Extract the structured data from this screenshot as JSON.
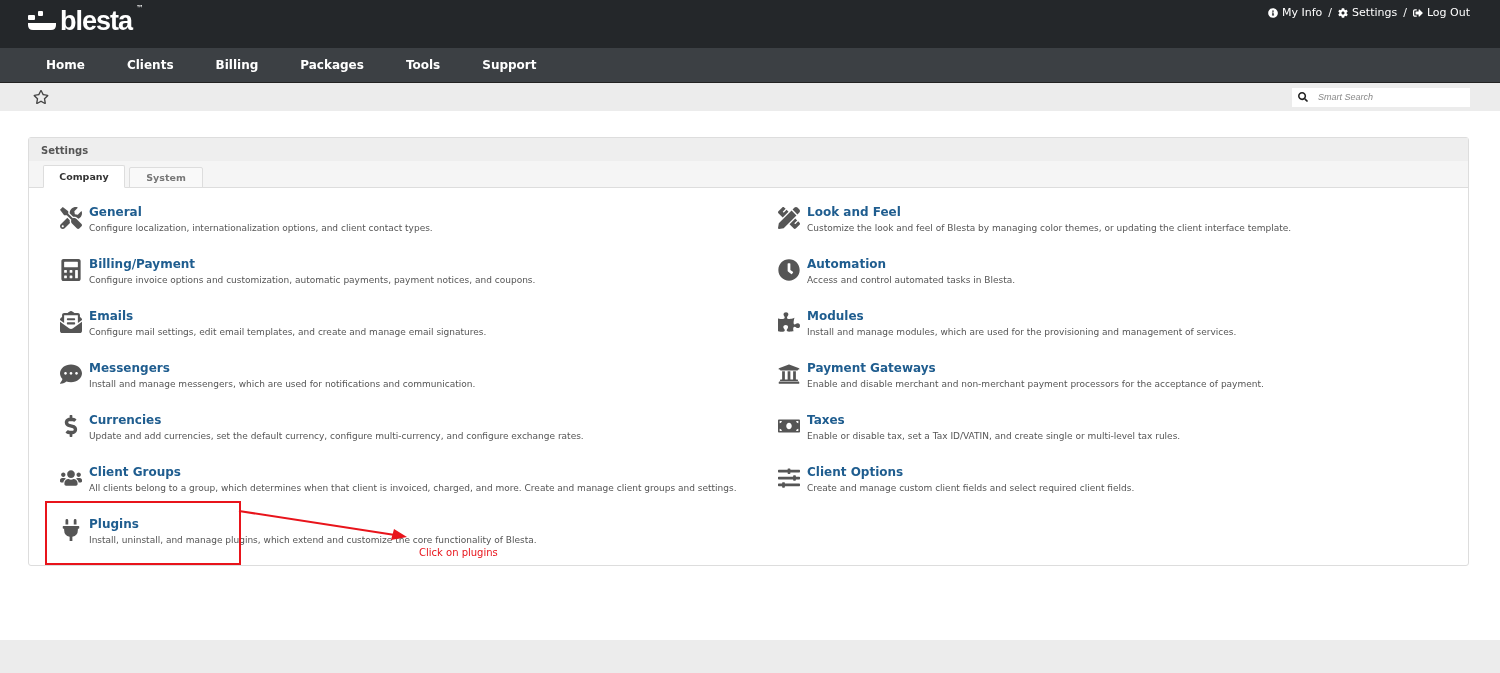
{
  "logo": {
    "text": "blesta",
    "trademark": "™"
  },
  "user_links": [
    {
      "label": "My Info",
      "kind": "info"
    },
    {
      "label": "Settings",
      "kind": "gear"
    },
    {
      "label": "Log Out",
      "kind": "logout"
    }
  ],
  "separator": "/",
  "nav": [
    "Home",
    "Clients",
    "Billing",
    "Packages",
    "Tools",
    "Support"
  ],
  "search": {
    "placeholder": "Smart Search"
  },
  "panel": {
    "title": "Settings",
    "tabs": [
      {
        "label": "Company",
        "selected": true
      },
      {
        "label": "System",
        "selected": false
      }
    ],
    "left_items": [
      {
        "title": "General",
        "description": "Configure localization, internationalization options, and client contact types."
      },
      {
        "title": "Billing/Payment",
        "description": "Configure invoice options and customization, automatic payments, payment notices, and coupons."
      },
      {
        "title": "Emails",
        "description": "Configure mail settings, edit email templates, and create and manage email signatures."
      },
      {
        "title": "Messengers",
        "description": "Install and manage messengers, which are used for notifications and communication."
      },
      {
        "title": "Currencies",
        "description": "Update and add currencies, set the default currency, configure multi-currency, and configure exchange rates."
      },
      {
        "title": "Client Groups",
        "description": "All clients belong to a group, which determines when that client is invoiced, charged, and more. Create and manage client groups and settings."
      },
      {
        "title": "Plugins",
        "description": "Install, uninstall, and manage plugins, which extend and customize the core functionality of Blesta.",
        "highlighted": true
      }
    ],
    "right_items": [
      {
        "title": "Look and Feel",
        "description": "Customize the look and feel of Blesta by managing color themes, or updating the client interface template."
      },
      {
        "title": "Automation",
        "description": "Access and control automated tasks in Blesta."
      },
      {
        "title": "Modules",
        "description": "Install and manage modules, which are used for the provisioning and management of services."
      },
      {
        "title": "Payment Gateways",
        "description": "Enable and disable merchant and non-merchant payment processors for the acceptance of payment."
      },
      {
        "title": "Taxes",
        "description": "Enable or disable tax, set a Tax ID/VATIN, and create single or multi-level tax rules."
      },
      {
        "title": "Client Options",
        "description": "Create and manage custom client fields and select required client fields."
      }
    ]
  },
  "annotation": {
    "text": "Click on plugins"
  }
}
